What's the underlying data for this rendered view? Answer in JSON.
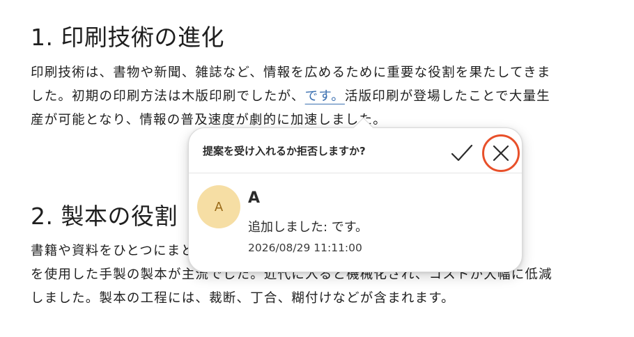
{
  "document": {
    "section1": {
      "heading": "1. 印刷技術の進化",
      "lines": [
        "印刷技術は、書物や新聞、雑誌など、情報を広めるために重要な役割を果たしてきま",
        "した。初期の印刷方法は木版印刷でしたが、",
        "産が可能となり、情報の普及速度が劇的に加速しました。"
      ],
      "suggestion_text": "です。",
      "line2_tail": "活版印刷が登場したことで大量生"
    },
    "section2": {
      "heading": "2. 製本の役割",
      "lines": [
        "書籍や資料をひとつにまとめる製本技術も重要です。かつては羊皮紙や木板",
        "を使用した手製の製本が主流でした。近代に入ると機械化され、コストが大幅に低減",
        "しました。製本の工程には、裁断、丁合、糊付けなどが含まれます。"
      ]
    }
  },
  "popup": {
    "question": "提案を受け入れるか拒否しますか?",
    "accept_icon": "check-icon",
    "reject_icon": "close-icon",
    "author_initial": "A",
    "author_name": "A",
    "change_description": "追加しました: です。",
    "timestamp": "2026/08/29 11:11:00"
  },
  "colors": {
    "suggestion_link": "#3a6fb0",
    "avatar_bg": "#f6dea4",
    "avatar_text": "#9a6a18",
    "reject_highlight": "#e8502a"
  }
}
